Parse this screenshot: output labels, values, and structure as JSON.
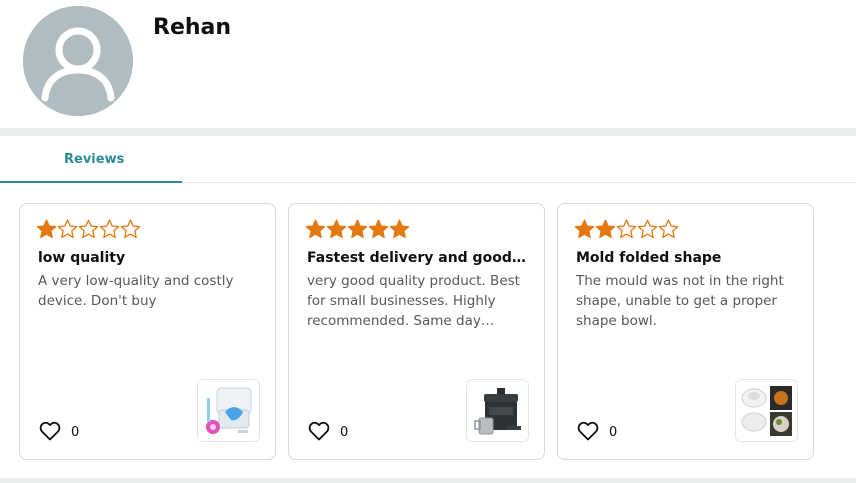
{
  "profile": {
    "name": "Rehan"
  },
  "tabs": [
    {
      "label": "Reviews",
      "active": true
    }
  ],
  "colors": {
    "accent": "#2a8c96",
    "star": "#e47911",
    "avatar_bg": "#b0bcc0"
  },
  "reviews": [
    {
      "rating": 1,
      "title": "low quality",
      "body": "A very low-quality and costly device. Don't buy",
      "likes": "0",
      "thumbnail_icon": "product-dental-device-icon"
    },
    {
      "rating": 5,
      "title": "Fastest delivery and good quality",
      "body": "very good quality product. Best for small businesses. Highly recommended. Same day delivery",
      "likes": "0",
      "thumbnail_icon": "product-fryer-icon"
    },
    {
      "rating": 2,
      "title": "Mold folded shape",
      "body": "The mould was not in the right shape, unable to get a proper shape bowl.",
      "likes": "0",
      "thumbnail_icon": "product-bowl-mould-icon"
    }
  ]
}
